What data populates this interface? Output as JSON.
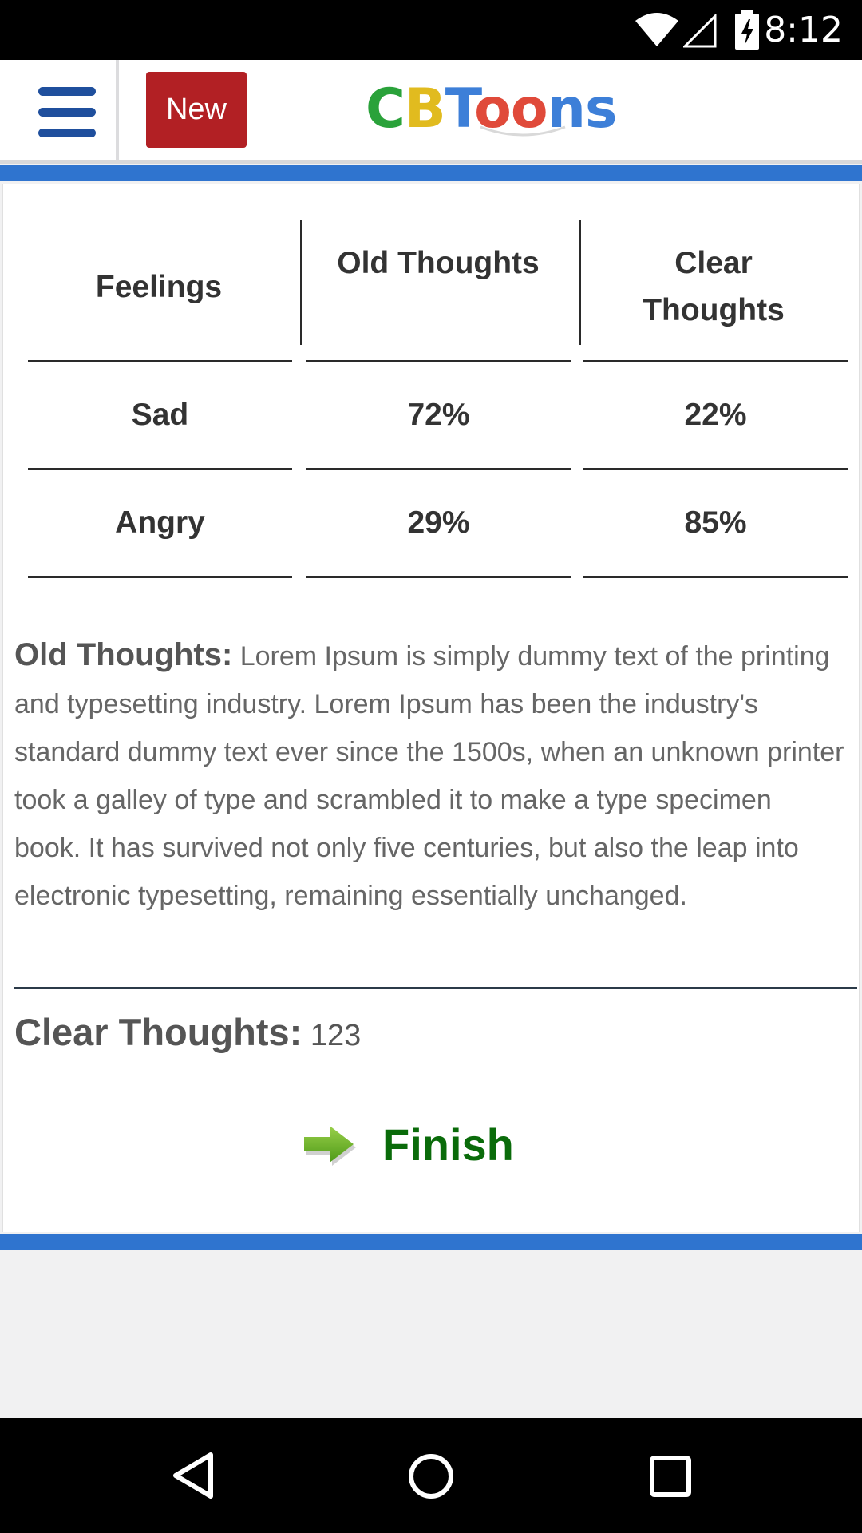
{
  "status_bar": {
    "time": "8:12",
    "icons": [
      "wifi-icon",
      "signal-icon",
      "battery-charging-icon"
    ]
  },
  "header": {
    "menu_icon": "hamburger-menu-icon",
    "new_button_label": "New",
    "logo": {
      "text": "CBToons",
      "parts": [
        "C",
        "B",
        "T",
        "oo",
        "ns"
      ]
    }
  },
  "colors": {
    "accent_blue": "#2f74cf",
    "new_button_red": "#b22024",
    "finish_green": "#0a6b0a",
    "logo_green": "#2aa23a",
    "logo_yellow": "#e1bb1f",
    "logo_blue": "#3d7fd8",
    "logo_red": "#e04a3a"
  },
  "table": {
    "headers": [
      "Feelings",
      "Old Thoughts",
      "Clear Thoughts"
    ],
    "rows": [
      {
        "feeling": "Sad",
        "old": "72%",
        "clear": "22%"
      },
      {
        "feeling": "Angry",
        "old": "29%",
        "clear": "85%"
      }
    ]
  },
  "old_thoughts": {
    "label": "Old Thoughts:",
    "text": "Lorem Ipsum is simply dummy text of the printing and typesetting industry. Lorem Ipsum has been the industry's standard dummy text ever since the 1500s, when an unknown printer took a galley of type and scrambled it to make a type specimen book. It has survived not only five centuries, but also the leap into electronic typesetting, remaining essentially unchanged."
  },
  "clear_thoughts": {
    "label": "Clear Thoughts:",
    "value": "123"
  },
  "finish": {
    "icon": "arrow-right-icon",
    "label": "Finish"
  },
  "nav_bar": {
    "icons": [
      "back-icon",
      "home-icon",
      "recents-icon"
    ]
  }
}
